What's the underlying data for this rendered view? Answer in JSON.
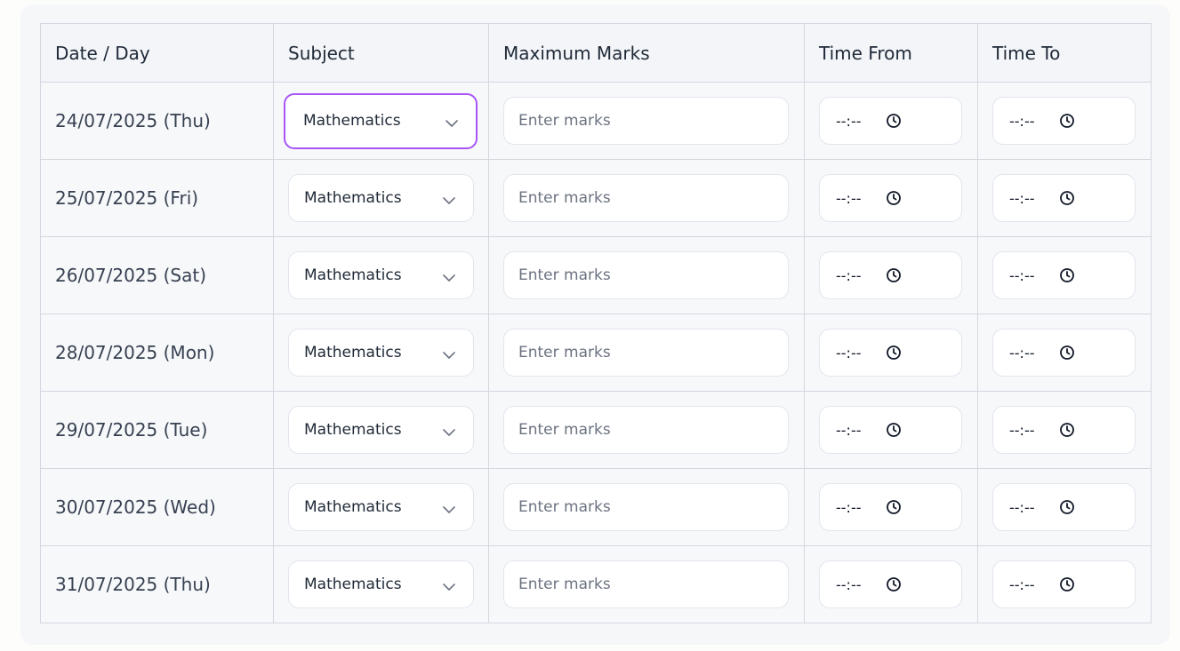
{
  "headers": {
    "date": "Date / Day",
    "subject": "Subject",
    "max_marks": "Maximum Marks",
    "time_from": "Time From",
    "time_to": "Time To"
  },
  "rows": [
    {
      "date": "24/07/2025 (Thu)",
      "subject": "Mathematics",
      "marks_placeholder": "Enter marks",
      "time_from": "--:--",
      "time_to": "--:--"
    },
    {
      "date": "25/07/2025 (Fri)",
      "subject": "Mathematics",
      "marks_placeholder": "Enter marks",
      "time_from": "--:--",
      "time_to": "--:--"
    },
    {
      "date": "26/07/2025 (Sat)",
      "subject": "Mathematics",
      "marks_placeholder": "Enter marks",
      "time_from": "--:--",
      "time_to": "--:--"
    },
    {
      "date": "28/07/2025 (Mon)",
      "subject": "Mathematics",
      "marks_placeholder": "Enter marks",
      "time_from": "--:--",
      "time_to": "--:--"
    },
    {
      "date": "29/07/2025 (Tue)",
      "subject": "Mathematics",
      "marks_placeholder": "Enter marks",
      "time_from": "--:--",
      "time_to": "--:--"
    },
    {
      "date": "30/07/2025 (Wed)",
      "subject": "Mathematics",
      "marks_placeholder": "Enter marks",
      "time_from": "--:--",
      "time_to": "--:--"
    },
    {
      "date": "31/07/2025 (Thu)",
      "subject": "Mathematics",
      "marks_placeholder": "Enter marks",
      "time_from": "--:--",
      "time_to": "--:--"
    }
  ],
  "focused_row": 0,
  "colors": {
    "focus_ring": "#a855f7",
    "border": "#d3d8e0",
    "header_bg": "#f3f5f8"
  },
  "icons": {
    "dropdown": "chevron-down-icon",
    "time": "clock-icon"
  }
}
